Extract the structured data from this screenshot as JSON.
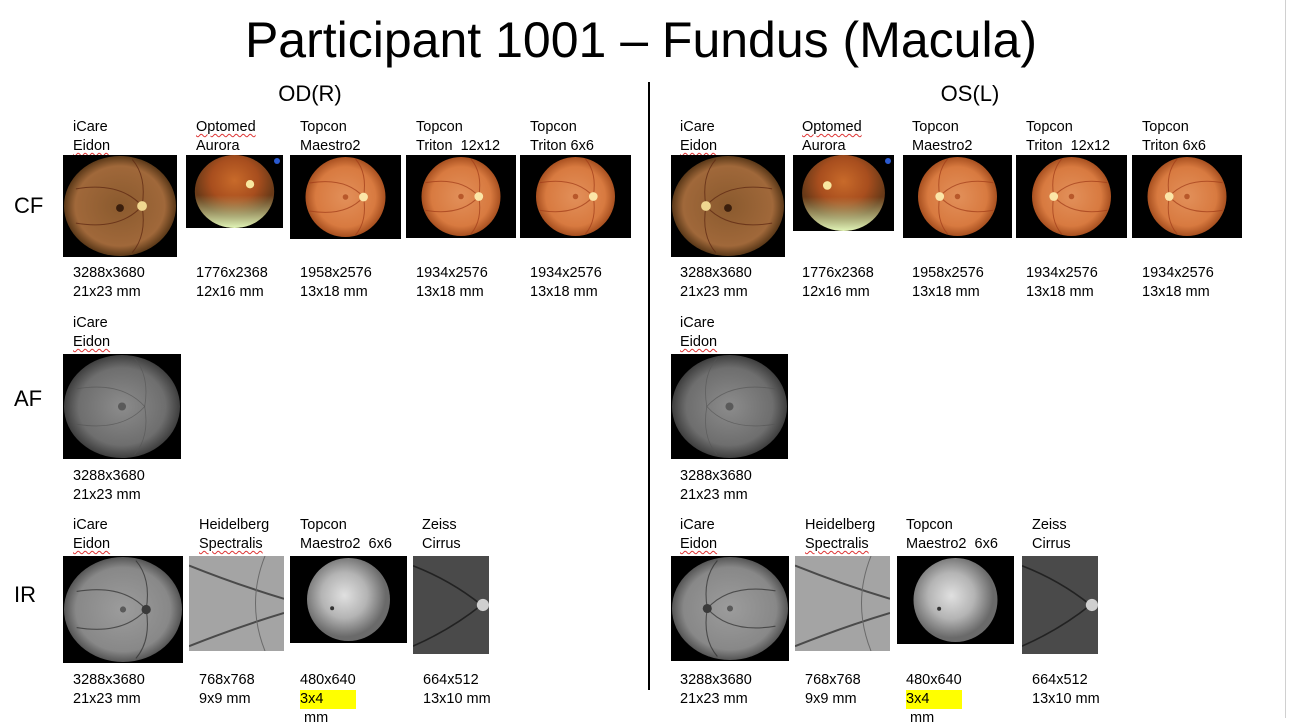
{
  "title": "Participant 1001 – Fundus (Macula)",
  "eyes": {
    "od": "OD(R)",
    "os": "OS(L)"
  },
  "rows": {
    "cf": "CF",
    "af": "AF",
    "ir": "IR"
  },
  "od": {
    "cf": [
      {
        "device": [
          "iCare",
          "Eidon"
        ],
        "res": "3288x3680",
        "size": "21x23 mm"
      },
      {
        "device": [
          "Optomed",
          "Aurora"
        ],
        "res": "1776x2368",
        "size": "12x16 mm"
      },
      {
        "device": [
          "Topcon",
          "Maestro2"
        ],
        "res": "1958x2576",
        "size": "13x18 mm"
      },
      {
        "device": [
          "Topcon",
          "Triton  12x12"
        ],
        "res": "1934x2576",
        "size": "13x18 mm"
      },
      {
        "device": [
          "Topcon",
          "Triton 6x6"
        ],
        "res": "1934x2576",
        "size": "13x18 mm"
      }
    ],
    "af": [
      {
        "device": [
          "iCare",
          "Eidon"
        ],
        "res": "3288x3680",
        "size": "21x23 mm"
      }
    ],
    "ir": [
      {
        "device": [
          "iCare",
          "Eidon"
        ],
        "res": "3288x3680",
        "size": "21x23 mm"
      },
      {
        "device": [
          "Heidelberg",
          "Spectralis"
        ],
        "res": "768x768",
        "size": "9x9 mm"
      },
      {
        "device": [
          "Topcon",
          "Maestro2  6x6"
        ],
        "res": "480x640",
        "size_hl": "3x4",
        "size_rest": " mm"
      },
      {
        "device": [
          "Zeiss",
          "Cirrus"
        ],
        "res": "664x512",
        "size": "13x10 mm"
      }
    ]
  },
  "os": {
    "cf": [
      {
        "device": [
          "iCare",
          "Eidon"
        ],
        "res": "3288x3680",
        "size": "21x23 mm"
      },
      {
        "device": [
          "Optomed",
          "Aurora"
        ],
        "res": "1776x2368",
        "size": "12x16 mm"
      },
      {
        "device": [
          "Topcon",
          "Maestro2"
        ],
        "res": "1958x2576",
        "size": "13x18 mm"
      },
      {
        "device": [
          "Topcon",
          "Triton  12x12"
        ],
        "res": "1934x2576",
        "size": "13x18 mm"
      },
      {
        "device": [
          "Topcon",
          "Triton 6x6"
        ],
        "res": "1934x2576",
        "size": "13x18 mm"
      }
    ],
    "af": [
      {
        "device": [
          "iCare",
          "Eidon"
        ],
        "res": "3288x3680",
        "size": "21x23 mm"
      }
    ],
    "ir": [
      {
        "device": [
          "iCare",
          "Eidon"
        ],
        "res": "3288x3680",
        "size": "21x23 mm"
      },
      {
        "device": [
          "Heidelberg",
          "Spectralis"
        ],
        "res": "768x768",
        "size": "9x9 mm"
      },
      {
        "device": [
          "Topcon",
          "Maestro2  6x6"
        ],
        "res": "480x640",
        "size_hl": "3x4",
        "size_rest": " mm"
      },
      {
        "device": [
          "Zeiss",
          "Cirrus"
        ],
        "res": "664x512",
        "size": "13x10 mm"
      }
    ]
  }
}
